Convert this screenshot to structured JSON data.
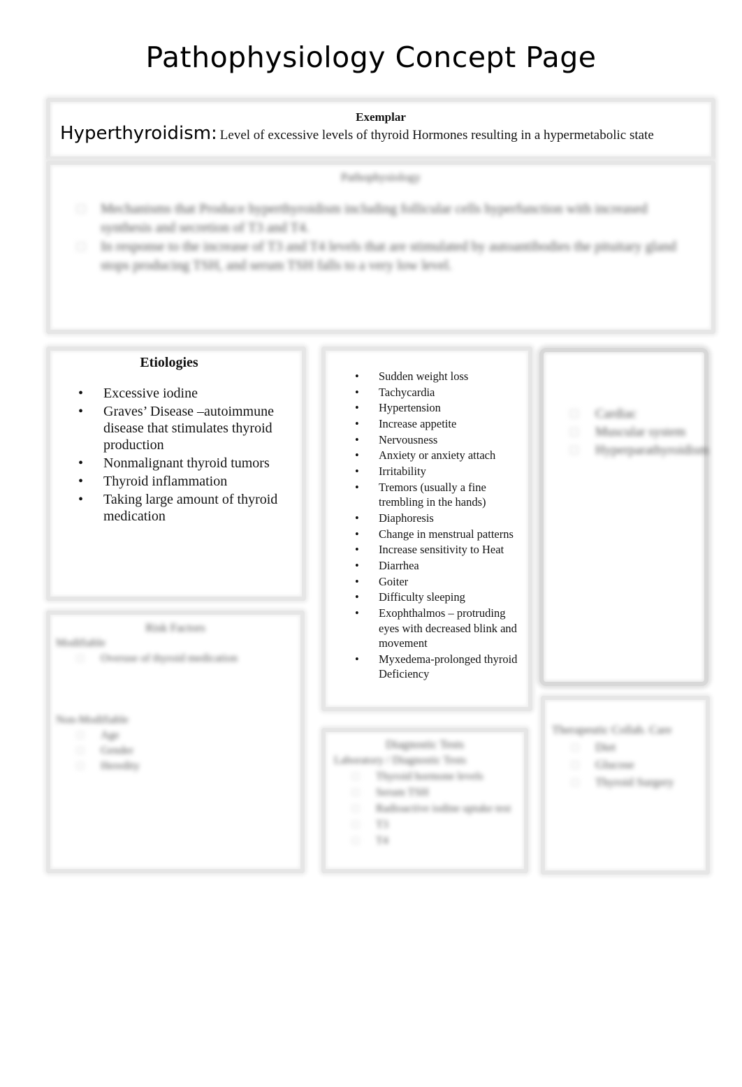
{
  "page": {
    "title": "Pathophysiology Concept Page"
  },
  "exemplar": {
    "label": "Exemplar",
    "disease": "Hyperthyroidism:",
    "definition": "Level of excessive levels of thyroid Hormones resulting in a hypermetabolic state"
  },
  "pathophysiology": {
    "title": "Pathophysiology",
    "items": [
      "Mechanisms that Produce hyperthyroidism including follicular cells hyperfunction with increased synthesis and secretion of T3 and T4.",
      "In response to the increase of T3 and T4 levels that are stimulated by autoantibodies the pituitary gland stops producing TSH, and serum TSH falls to a very low level."
    ]
  },
  "etiologies": {
    "title": "Etiologies",
    "items": [
      "Excessive iodine",
      "Graves’ Disease –autoimmune disease that stimulates thyroid production",
      "Nonmalignant thyroid tumors",
      "Thyroid inflammation",
      "Taking large amount of thyroid medication"
    ]
  },
  "signs_symptoms": {
    "items": [
      "Sudden weight loss",
      "Tachycardia",
      "Hypertension",
      "Increase appetite",
      "Nervousness",
      "Anxiety or anxiety attach",
      "Irritability",
      "Tremors (usually a fine trembling in the hands)",
      "Diaphoresis",
      "Change in menstrual patterns",
      "Increase sensitivity to Heat",
      "Diarrhea",
      "Goiter",
      "Difficulty sleeping",
      "Exophthalmos – protruding eyes with decreased blink and movement",
      "Myxedema-prolonged thyroid Deficiency"
    ]
  },
  "complications": {
    "items": [
      "Cardiac",
      "Muscular system",
      "Hyperparathyroidism"
    ]
  },
  "risk_factors": {
    "title": "Risk Factors",
    "modifiable_label": "Modifiable",
    "modifiable_items": [
      "Overuse of thyroid medication"
    ],
    "nonmodifiable_label": "Non-Modifiable",
    "nonmodifiable_items": [
      "Age",
      "Gender",
      "Heredity"
    ]
  },
  "diagnostics": {
    "title": "Diagnostic Tests",
    "subtitle": "Laboratory / Diagnostic Tests",
    "items": [
      "Thyroid hormone levels",
      "Serum TSH",
      "Radioactive iodine uptake test",
      "T3",
      "T4"
    ]
  },
  "therapeutics": {
    "title": "Therapeutic Collab. Care",
    "items": [
      "Diet",
      "Glucose",
      "Thyroid Surgery"
    ]
  }
}
